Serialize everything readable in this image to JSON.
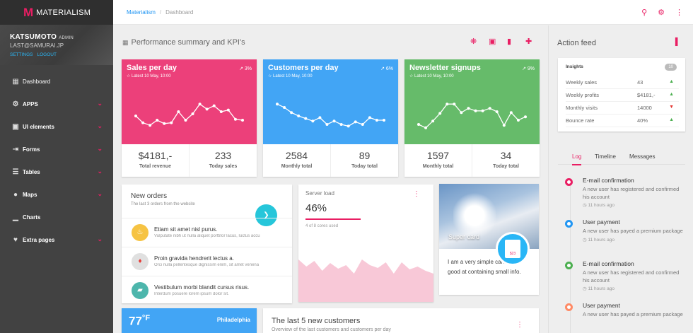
{
  "brand": {
    "logo": "M",
    "name": "MATERIALISM"
  },
  "profile": {
    "name": "KATSUMOTO",
    "role": "ADMIN",
    "email": "LAST@SAMURAI.JP",
    "links": [
      "SETTINGS",
      "LOGOUT"
    ]
  },
  "nav": [
    {
      "label": "Dashboard",
      "icon": "dashboard-icon",
      "chevron": false
    },
    {
      "label": "APPS",
      "icon": "apps-icon",
      "chevron": true
    },
    {
      "label": "UI elements",
      "icon": "ui-elements-icon",
      "chevron": true
    },
    {
      "label": "Forms",
      "icon": "forms-icon",
      "chevron": true
    },
    {
      "label": "Tables",
      "icon": "tables-icon",
      "chevron": true
    },
    {
      "label": "Maps",
      "icon": "maps-icon",
      "chevron": true
    },
    {
      "label": "Charts",
      "icon": "charts-icon",
      "chevron": false
    },
    {
      "label": "Extra pages",
      "icon": "extra-pages-icon",
      "chevron": true
    }
  ],
  "breadcrumb": [
    "Materialism",
    "Dashboard"
  ],
  "section": {
    "title": "Performance summary and KPI's"
  },
  "kpis": [
    {
      "title": "Sales per day",
      "sub": "Latest 10 May, 10:00",
      "pct": "3%",
      "color": "#ec407a",
      "values": [
        50,
        34,
        28,
        40,
        32,
        34,
        60,
        40,
        55,
        78,
        66,
        74,
        60,
        64,
        42,
        40
      ],
      "stat1": "$4181,-",
      "label1": "Total revenue",
      "stat2": "233",
      "label2": "Today sales"
    },
    {
      "title": "Customers per day",
      "sub": "Latest 10 May, 10:00",
      "pct": "6%",
      "color": "#42a5f5",
      "values": [
        78,
        70,
        58,
        50,
        44,
        38,
        46,
        30,
        38,
        30,
        26,
        36,
        30,
        46,
        40,
        40
      ],
      "stat1": "2584",
      "label1": "Monthly total",
      "stat2": "89",
      "label2": "Today total"
    },
    {
      "title": "Newsletter signups",
      "sub": "Latest 10 May, 10:00",
      "pct": "9%",
      "color": "#66bb6a",
      "values": [
        30,
        22,
        38,
        56,
        78,
        78,
        58,
        68,
        62,
        62,
        68,
        60,
        28,
        58,
        40,
        48
      ],
      "stat1": "1597",
      "label1": "Monthly total",
      "stat2": "34",
      "label2": "Today total"
    }
  ],
  "orders": {
    "title": "New orders",
    "sub": "The last 3 orders from the website",
    "items": [
      {
        "title": "Etiam sit amet nisl purus.",
        "desc": "Vulputate nibh ut nulla aliquet porttitor lacus, luctus accu",
        "icon": "fire-icon",
        "color": "#f6c343"
      },
      {
        "title": "Proin gravida hendrerit lectus a.",
        "desc": "Orci nulla pellentesque dignissim enim, sit amet venena",
        "icon": "tie-icon",
        "color": "#e0e0e0"
      },
      {
        "title": "Vestibulum morbi blandit cursus risus.",
        "desc": "Interdum posuere lorem ipsum dolor sit.",
        "icon": "shoe-icon",
        "color": "#4db6ac"
      }
    ]
  },
  "server": {
    "title": "Server load",
    "value": "46%",
    "cores": "4 of 8 cores used",
    "load": [
      60,
      50,
      58,
      44,
      55,
      47,
      52,
      40,
      60,
      52,
      48,
      56,
      40,
      56,
      46,
      50,
      44,
      40
    ]
  },
  "supercard": {
    "title": "Super card",
    "text": "I am a very simple card. I am good at containing small info.",
    "badge": "$23"
  },
  "weather": {
    "temp": "77",
    "unit": "°F",
    "city": "Philadelphia"
  },
  "customers": {
    "title": "The last 5 new customers",
    "sub": "Overview of the last customers and customers per day"
  },
  "feed": {
    "title": "Action feed",
    "insights_title": "Insights",
    "insights_count": "10",
    "insights": [
      {
        "label": "Weekly sales",
        "value": "43",
        "trend": "up"
      },
      {
        "label": "Weekly profits",
        "value": "$4181,-",
        "trend": "up"
      },
      {
        "label": "Monthly visits",
        "value": "14000",
        "trend": "down"
      },
      {
        "label": "Bounce rate",
        "value": "40%",
        "trend": "up"
      }
    ],
    "tabs": [
      "Log",
      "Timeline",
      "Messages"
    ],
    "log": [
      {
        "title": "E-mail confirmation",
        "desc": "A new user has registered and confirmed his account",
        "ago": "11 hours ago",
        "color": "#e91e63"
      },
      {
        "title": "User payment",
        "desc": "A new user has payed a premium package",
        "ago": "11 hours ago",
        "color": "#2196f3"
      },
      {
        "title": "E-mail confirmation",
        "desc": "A new user has registered and confirmed his account",
        "ago": "11 hours ago",
        "color": "#4caf50"
      },
      {
        "title": "User payment",
        "desc": "A new user has payed a premium package",
        "ago": "",
        "color": "#ff8a65"
      }
    ]
  }
}
